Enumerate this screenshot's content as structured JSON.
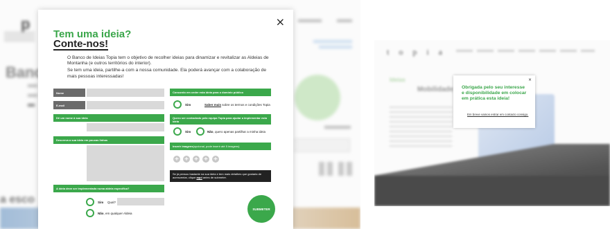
{
  "modal": {
    "close_symbol": "×",
    "title_line1": "Tem uma ideia?",
    "title_line2": "Conte-nos!",
    "intro_p1": "O Banco de Ideias Topia tem o objetivo de recolher ideias para dinamizar e revitalizar as Aldeias de Montanha (e outros territórios do interior).",
    "intro_p2": "Se tem uma ideia, partilhe-a com a nossa comunidade. Ela poderá avançar com a colaboração de mais pessoas interessadas!"
  },
  "form_left": {
    "name_label": "Nome",
    "email_label": "E-mail",
    "idea_name_label": "Dê um nome à sua ideia",
    "idea_desc_label": "Descreva a sua ideia em poucas linhas",
    "implementation_label": "A ideia deve ser implementada numa aldeia específica?",
    "yes_label": "Sim",
    "which_label": "Qual?",
    "no_label": "Não",
    "no_suffix": ", em qualquer Aldeia"
  },
  "form_right": {
    "consent_label": "Concordo em ceder esta ideia para o domínio público",
    "consent_yes": "Sim",
    "consent_link": "Saber mais",
    "consent_link_suffix": " sobre os termos e condições Topia",
    "contact_label": "Quero ser contactado pela equipa Topia para ajudar a implementar esta ideia",
    "contact_yes": "Sim",
    "contact_no": "Não",
    "contact_no_suffix": ", quero apenas partilhar a minha ideia",
    "images_label": "Inserir imagens",
    "images_hint": " (opcional, pode inserir até 5 imagens)",
    "plus_symbol": "+",
    "note_text_1": "Se já pensou bastante na sua ideia e tem mais detalhes que gostaria de acrescentar, clique ",
    "note_link": "aqui",
    "note_text_2": " antes de submeter.",
    "submit_label": "SUBMETER"
  },
  "popup": {
    "close_symbol": "×",
    "title": "Obrigada pelo seu interesse e disponibilidade em colocar em prática esta ideia!",
    "text": "Em breve vamos entrar em contacto consigo."
  },
  "background": {
    "left_logo": "p",
    "left_title": "Banc",
    "left_bottom": "a esco",
    "right_logo": "topia",
    "right_ideias": "Ideias",
    "right_heading": "Mobilidade Partil"
  },
  "colors": {
    "accent_green": "#3ba84b",
    "label_gray": "#6b6b6b",
    "note_black": "#222222"
  }
}
